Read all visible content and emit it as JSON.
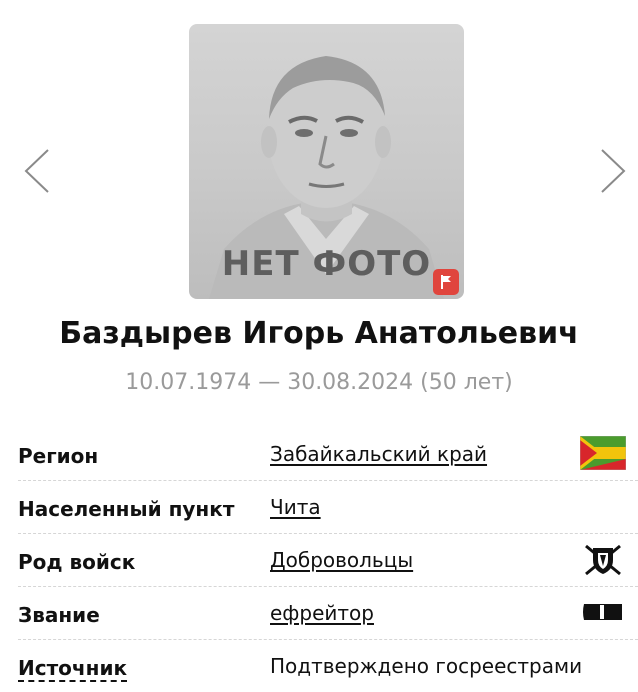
{
  "profile": {
    "photo_placeholder": "НЕТ ФОТО",
    "name": "Баздырев Игорь Анатольевич",
    "dates": "10.07.1974 — 30.08.2024 (50 лет)"
  },
  "info": {
    "region": {
      "label": "Регион",
      "value": "Забайкальский край",
      "icon": "zabaykalsky-flag-icon"
    },
    "locality": {
      "label": "Населенный пункт",
      "value": "Чита"
    },
    "branch": {
      "label": "Род войск",
      "value": "Добровольцы",
      "icon": "volunteers-emblem-icon"
    },
    "rank": {
      "label": "Звание",
      "value": "ефрейтор",
      "icon": "rank-insignia-icon"
    },
    "source": {
      "label": "Источник",
      "value": "Подтверждено госреестрами"
    }
  },
  "colors": {
    "flag_green": "#4a9c2d",
    "flag_yellow": "#f2c40c",
    "flag_red": "#d8262b",
    "badge_red": "#e0453d",
    "muted_text": "#9a9a9a"
  }
}
